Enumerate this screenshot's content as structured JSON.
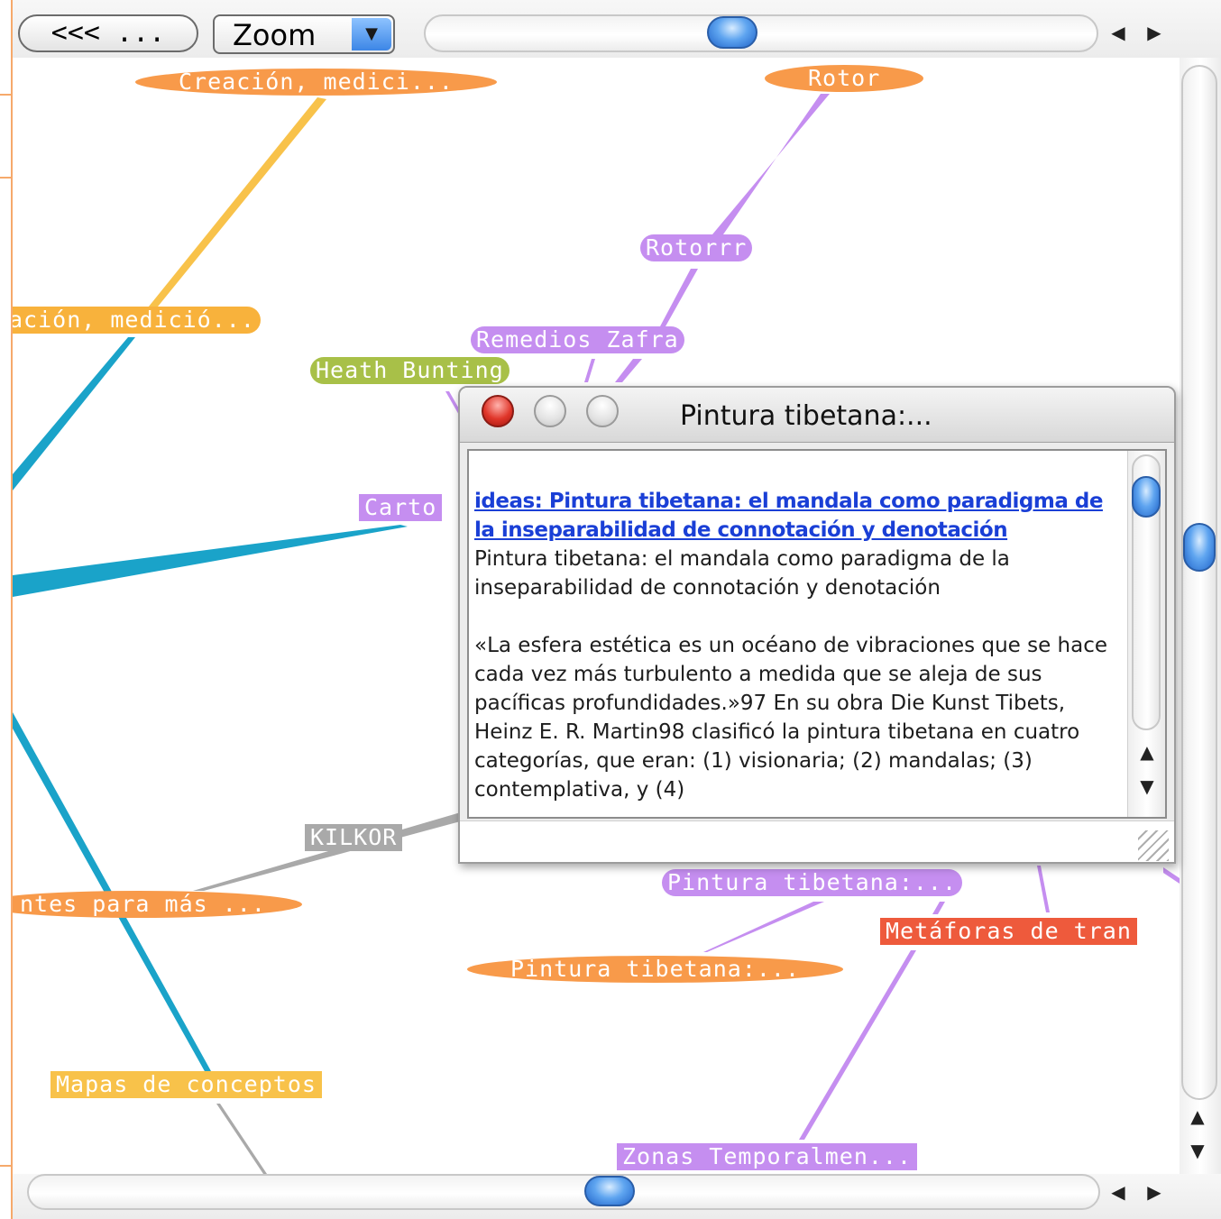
{
  "toolbar": {
    "back_label": "<<< ...",
    "zoom_label": "Zoom",
    "zoom_arrow": "▼",
    "scroll_left": "◀",
    "scroll_right": "▶"
  },
  "nodes": [
    {
      "label": "Creación, medici...",
      "color": "#f89a4a",
      "shape": "ellipse"
    },
    {
      "label": "Rotor",
      "color": "#f89a4a",
      "shape": "ellipse"
    },
    {
      "label": "Rotorrr",
      "color": "#c58ef0",
      "shape": "pill"
    },
    {
      "label": "ación, medició...",
      "color": "#f8b23c",
      "shape": "pill"
    },
    {
      "label": "Remedios Zafra",
      "color": "#c58ef0",
      "shape": "pill"
    },
    {
      "label": "Heath Bunting",
      "color": "#a8c048",
      "shape": "pill"
    },
    {
      "label": "Carto",
      "color": "#c58ef0",
      "shape": "box"
    },
    {
      "label": "KILKOR",
      "color": "#a9a9a9",
      "shape": "box"
    },
    {
      "label": "ntes para más ...",
      "color": "#f89a4a",
      "shape": "ellipse"
    },
    {
      "label": "Pintura tibetana:...",
      "color": "#c58ef0",
      "shape": "pill"
    },
    {
      "label": "Metáforas de tran",
      "color": "#ee5a3c",
      "shape": "box"
    },
    {
      "label": "Pintura tibetana:...",
      "color": "#f89a4a",
      "shape": "ellipse"
    },
    {
      "label": "Mapas de conceptos",
      "color": "#f8c24a",
      "shape": "box"
    },
    {
      "label": "Zonas Temporalmen...",
      "color": "#c58ef0",
      "shape": "box"
    }
  ],
  "popup": {
    "title": "Pintura tibetana:...",
    "link_text": "ideas: Pintura tibetana: el mandala como paradigma de la inseparabilidad de connotación y denotación",
    "heading": "Pintura tibetana: el mandala como paradigma de la inseparabilidad de connotación y denotación",
    "body": "«La esfera estética es un océano de vibraciones que se hace cada vez más turbulento a medida que se aleja de sus pacíficas profundidades.»97 En su obra Die Kunst Tibets, Heinz E. R. Martin98 clasificó la pintura tibetana en cuatro categorías, que eran: (1) visionaria; (2) mandalas; (3) contemplativa, y (4)",
    "scroll_up": "▲",
    "scroll_down": "▼"
  },
  "scrollbars": {
    "v_up": "▲",
    "v_down": "▼",
    "h_left": "◀",
    "h_right": "▶"
  }
}
